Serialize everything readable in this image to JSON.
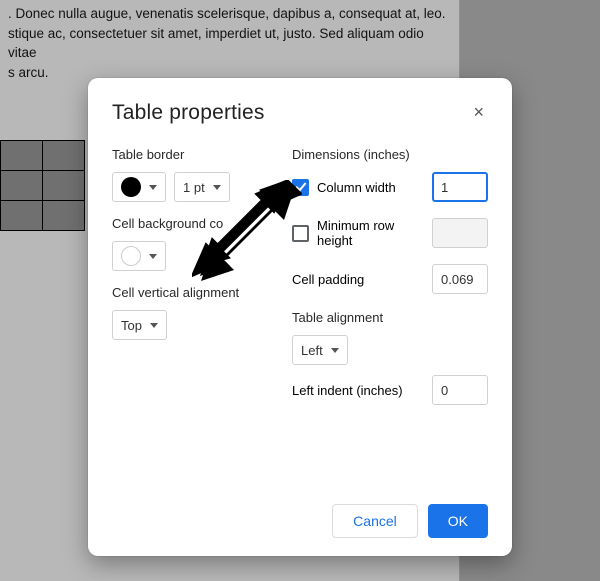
{
  "doc": {
    "line1": ". Donec nulla augue, venenatis scelerisque, dapibus a, consequat at, leo.",
    "line2": "stique ac, consectetuer sit amet, imperdiet ut, justo. Sed aliquam odio vitae",
    "line3": "s arcu."
  },
  "modal": {
    "title": "Table properties",
    "left": {
      "border_label": "Table border",
      "border_width": "1 pt",
      "bg_label": "Cell background co",
      "valign_label": "Cell vertical alignment",
      "valign_value": "Top"
    },
    "right": {
      "dims_label": "Dimensions  (inches)",
      "colwidth_label": "Column width",
      "colwidth_value": "1",
      "rowheight_label": "Minimum row height",
      "rowheight_value": "",
      "padding_label": "Cell padding",
      "padding_value": "0.069",
      "align_label": "Table alignment",
      "align_value": "Left",
      "indent_label": "Left indent  (inches)",
      "indent_value": "0"
    },
    "buttons": {
      "cancel": "Cancel",
      "ok": "OK"
    }
  }
}
